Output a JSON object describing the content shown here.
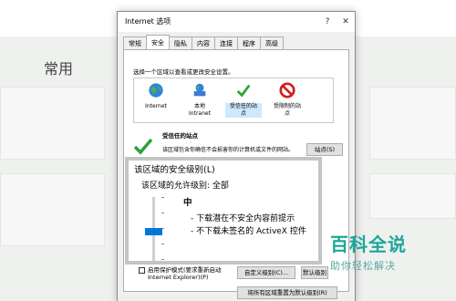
{
  "background": {
    "heading": "常用"
  },
  "dialog": {
    "title": "Internet 选项",
    "help_label": "?",
    "close_label": "✕",
    "tabs": [
      "常规",
      "安全",
      "隐私",
      "内容",
      "连接",
      "程序",
      "高级"
    ],
    "active_tab": 1,
    "hint": "选择一个区域以查看或更改安全设置。",
    "zones": [
      {
        "label": "Internet",
        "icon": "globe-icon"
      },
      {
        "label": "本地\nIntranet",
        "icon": "intranet-icon"
      },
      {
        "label": "受信任的站\n点",
        "icon": "check-icon"
      },
      {
        "label": "受限制的站\n点",
        "icon": "restricted-icon"
      }
    ],
    "selected_zone": 2,
    "site_title": "受信任的站点",
    "site_desc": "该区域包含你确信不会损害你的计算机或文件的网站。",
    "sites_button": "站点(S)",
    "protected_mode": "启用保护模式(要求重新启动\nInternet Explorer)(P)",
    "custom_level_button": "自定义级别(C)...",
    "default_level_button": "默认级别(D)",
    "reset_all_button": "将所有区域重置为默认级别(R)"
  },
  "zoom": {
    "frame_title": "该区域的安全级别(L)",
    "allowed": "该区域的允许级别: 全部",
    "level": "中",
    "desc1": "- 下载潜在不安全内容前提示",
    "desc2": "- 不下载未签名的 ActiveX 控件"
  },
  "watermark": {
    "title": "百科全说",
    "subtitle": "助你轻松解决"
  },
  "colors": {
    "accent": "#0078d7",
    "check_green": "#2aa33a",
    "restricted_red": "#d21e1e",
    "watermark": "#1aa89a"
  }
}
